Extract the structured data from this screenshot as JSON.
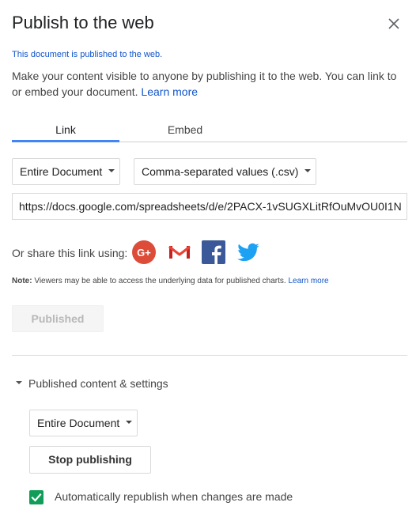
{
  "dialog": {
    "title": "Publish to the web",
    "close_icon": "close-icon"
  },
  "status_text": "This document is published to the web.",
  "description": {
    "text": "Make your content visible to anyone by publishing it to the web. You can link to or embed your document.",
    "learn_more": "Learn more"
  },
  "tabs": [
    {
      "label": "Link",
      "active": true
    },
    {
      "label": "Embed",
      "active": false
    }
  ],
  "link": {
    "scope_select": "Entire Document",
    "format_select": "Comma-separated values (.csv)",
    "url": "https://docs.google.com/spreadsheets/d/e/2PACX-1vSUGXLitRfOuMvOU0I1N"
  },
  "share": {
    "label": "Or share this link using:",
    "icons": [
      "google-plus-icon",
      "gmail-icon",
      "facebook-icon",
      "twitter-icon"
    ]
  },
  "note": {
    "prefix": "Note:",
    "text": "Viewers may be able to access the underlying data for published charts.",
    "learn_more": "Learn more"
  },
  "published_button": "Published",
  "settings": {
    "toggle_label": "Published content & settings",
    "scope_select": "Entire Document",
    "stop_button": "Stop publishing",
    "auto_republish_label": "Automatically republish when changes are made",
    "auto_republish_checked": true
  },
  "colors": {
    "accent_blue": "#4285f4",
    "link_blue": "#1155cc",
    "check_green": "#0f9d58",
    "google_plus_red": "#dd4b39",
    "facebook_blue": "#3b5998",
    "twitter_blue": "#1da1f2"
  }
}
